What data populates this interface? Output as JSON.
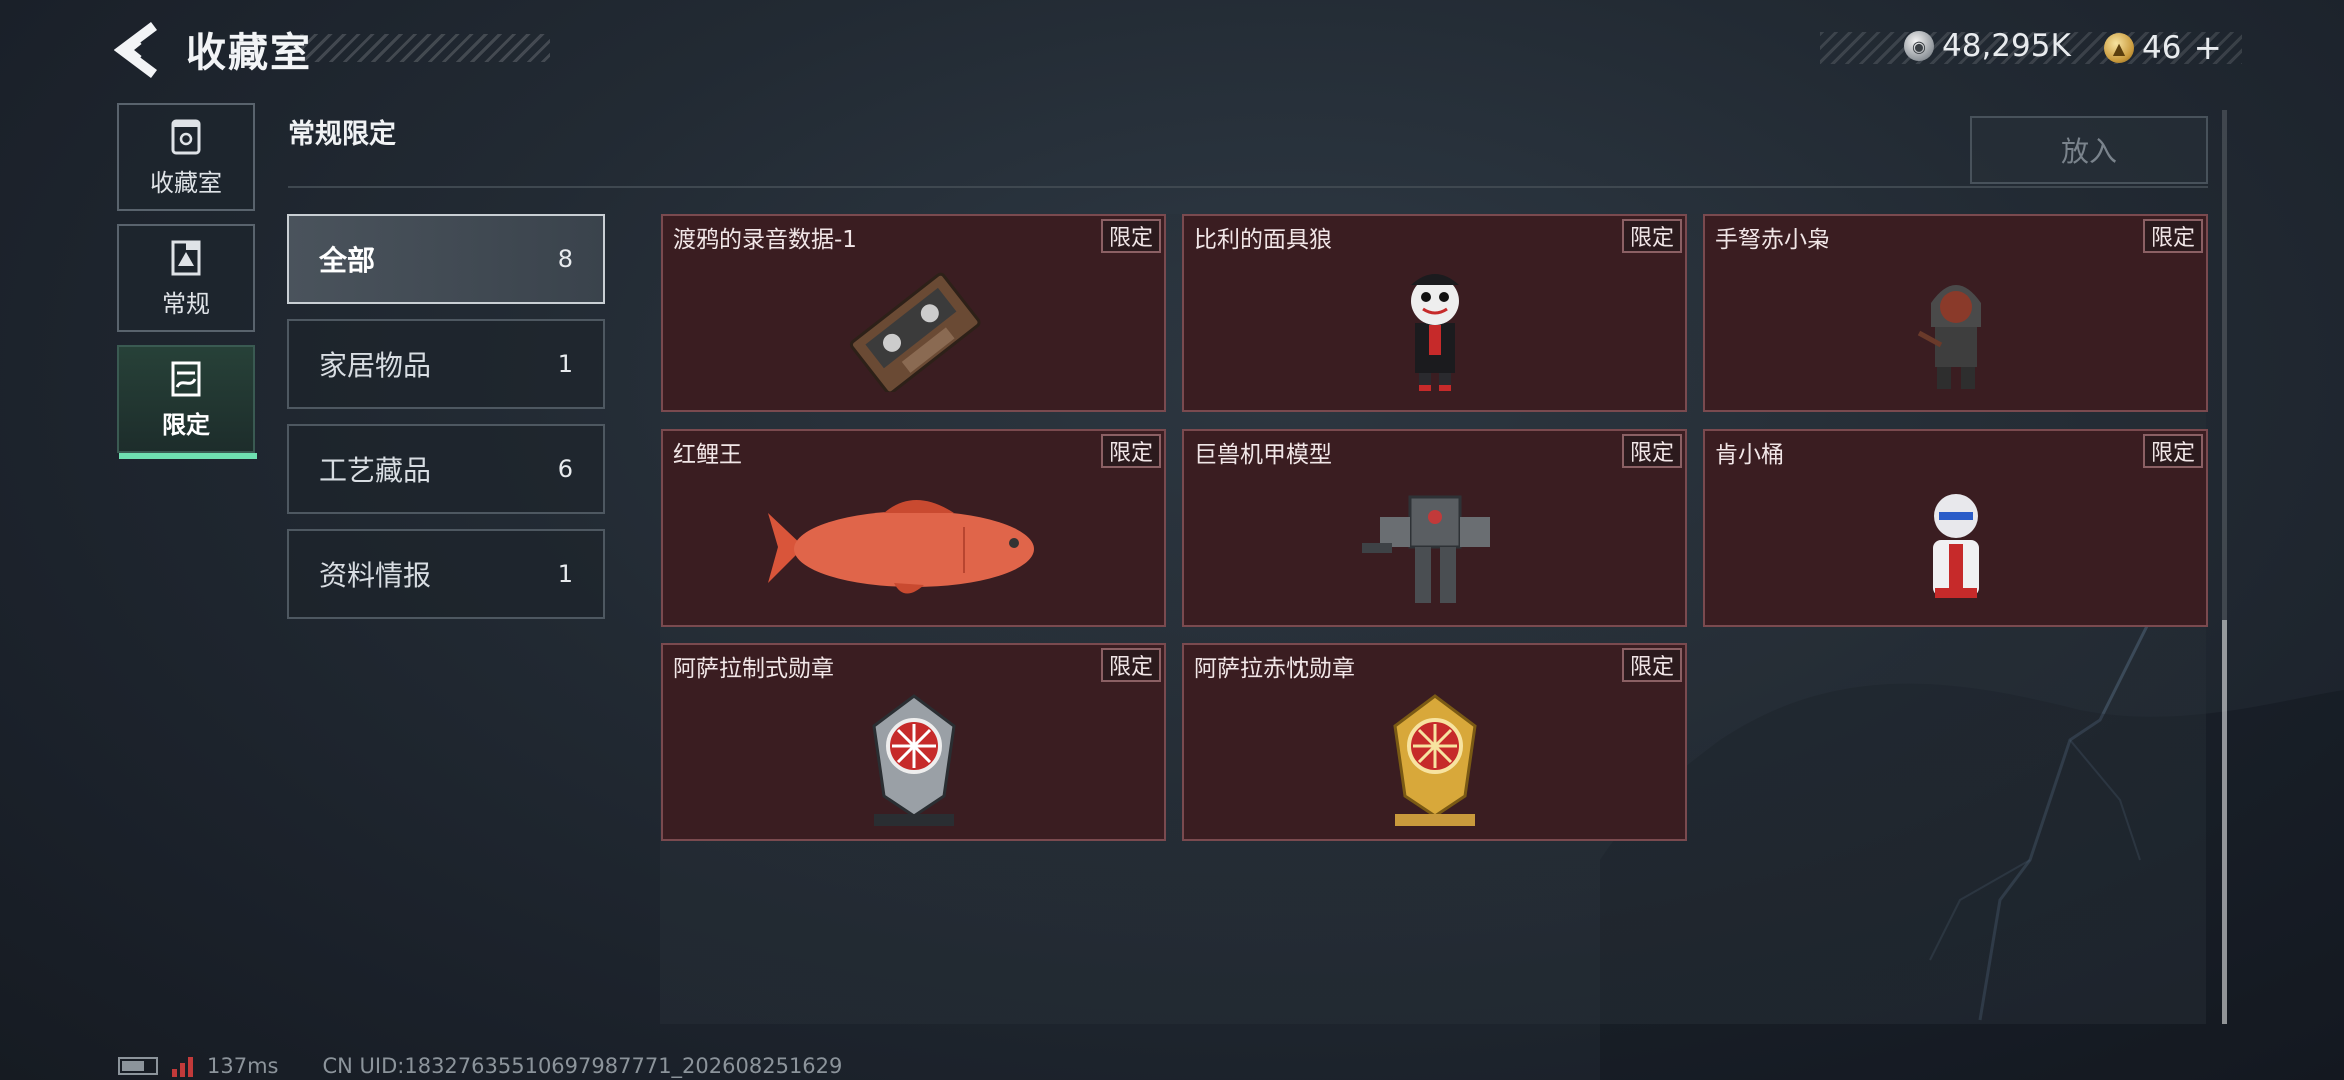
{
  "header": {
    "title": "收藏室",
    "currencies": [
      {
        "icon": "silver-coin-icon",
        "value": "48,295K"
      },
      {
        "icon": "gold-coin-icon",
        "value": "46",
        "plus": "+"
      }
    ]
  },
  "nav": {
    "items": [
      {
        "label": "收藏室",
        "icon": "collection-room-icon",
        "active": false
      },
      {
        "label": "常规",
        "icon": "regular-icon",
        "active": false
      },
      {
        "label": "限定",
        "icon": "limited-icon",
        "active": true
      }
    ]
  },
  "section": {
    "title": "常规限定",
    "place_button": "放入"
  },
  "categories": [
    {
      "label": "全部",
      "count": "8",
      "active": true
    },
    {
      "label": "家居物品",
      "count": "1",
      "active": false
    },
    {
      "label": "工艺藏品",
      "count": "6",
      "active": false
    },
    {
      "label": "资料情报",
      "count": "1",
      "active": false
    }
  ],
  "items": [
    {
      "name": "渡鸦的录音数据-1",
      "tag": "限定",
      "art": "cassette-tape-icon"
    },
    {
      "name": "比利的面具狼",
      "tag": "限定",
      "art": "puppet-figure-icon"
    },
    {
      "name": "手弩赤小枭",
      "tag": "限定",
      "art": "hooded-figure-icon"
    },
    {
      "name": "红鲤王",
      "tag": "限定",
      "art": "red-carp-icon"
    },
    {
      "name": "巨兽机甲模型",
      "tag": "限定",
      "art": "mech-model-icon"
    },
    {
      "name": "肯小桶",
      "tag": "限定",
      "art": "bust-figure-icon"
    },
    {
      "name": "阿萨拉制式勋章",
      "tag": "限定",
      "art": "silver-medal-icon"
    },
    {
      "name": "阿萨拉赤忱勋章",
      "tag": "限定",
      "art": "gold-medal-icon"
    }
  ],
  "status": {
    "ping": "137ms",
    "uid": "CN UID:18327635510697987771_202608251629"
  },
  "colors": {
    "accent": "#6fe0b1",
    "card_bg": "#3a1d21",
    "card_border": "#7a4a4f"
  }
}
